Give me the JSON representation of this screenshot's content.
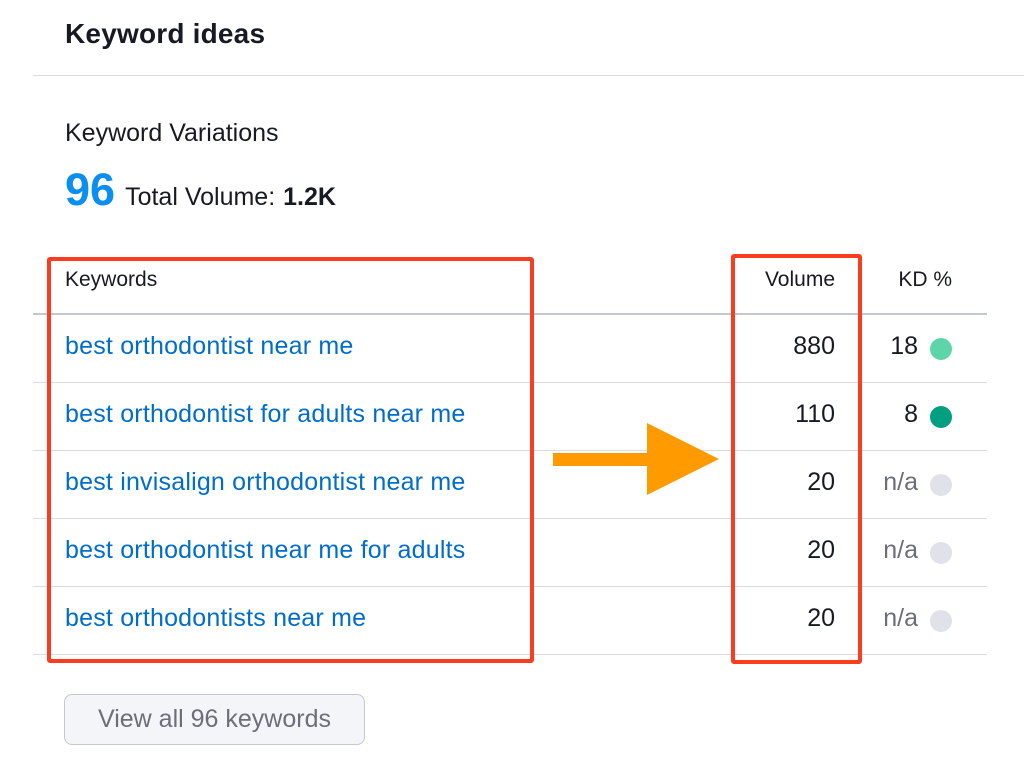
{
  "header": {
    "title": "Keyword ideas"
  },
  "section": {
    "title": "Keyword Variations",
    "count": "96",
    "total_volume_label": "Total Volume:",
    "total_volume_value": "1.2K"
  },
  "table": {
    "columns": {
      "keywords": "Keywords",
      "volume": "Volume",
      "kd": "KD %"
    },
    "rows": [
      {
        "keyword": "best orthodontist near me",
        "volume": "880",
        "kd": "18",
        "kd_color": "#5ed5a8"
      },
      {
        "keyword": "best orthodontist for adults near me",
        "volume": "110",
        "kd": "8",
        "kd_color": "#009f81"
      },
      {
        "keyword": "best invisalign orthodontist near me",
        "volume": "20",
        "kd": "n/a",
        "kd_color": "#e0e1e9"
      },
      {
        "keyword": "best orthodontist near me for adults",
        "volume": "20",
        "kd": "n/a",
        "kd_color": "#e0e1e9"
      },
      {
        "keyword": "best orthodontists near me",
        "volume": "20",
        "kd": "n/a",
        "kd_color": "#e0e1e9"
      }
    ]
  },
  "button": {
    "view_all_label": "View all 96 keywords"
  },
  "colors": {
    "accent": "#0a8ef0",
    "link": "#006dca",
    "highlight": "#fa3d1f",
    "arrow": "#ff9a00"
  },
  "icons": {
    "annotation_arrow": "arrow-right-icon"
  }
}
